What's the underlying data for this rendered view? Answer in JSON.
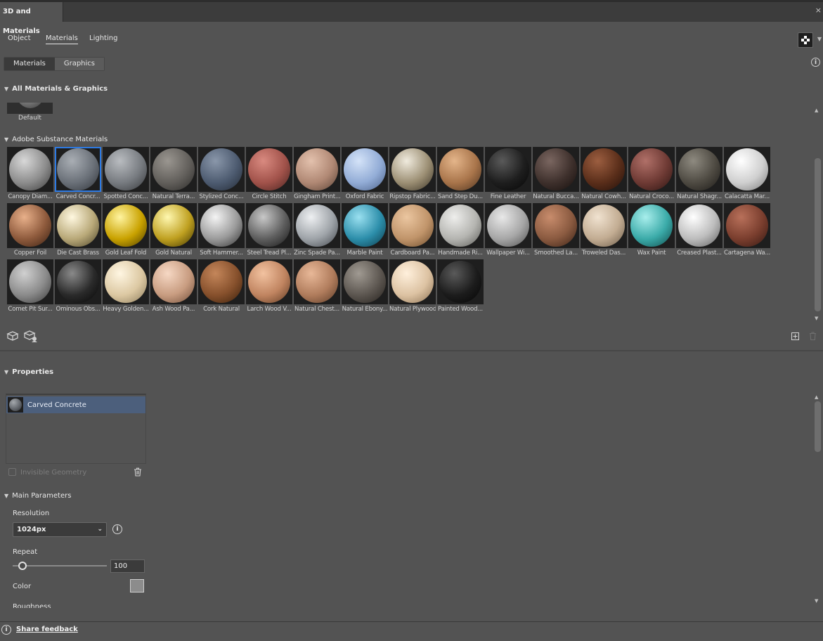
{
  "panel": {
    "title": "3D and Materials",
    "close_icon": "×"
  },
  "top_tabs": [
    {
      "label": "Object",
      "active": false
    },
    {
      "label": "Materials",
      "active": true
    },
    {
      "label": "Lighting",
      "active": false
    }
  ],
  "segment": {
    "materials": "Materials",
    "graphics": "Graphics",
    "active": "Materials"
  },
  "sections": {
    "all": "All Materials & Graphics",
    "default_label": "Default",
    "substance": "Adobe Substance Materials",
    "properties": "Properties",
    "main_params": "Main Parameters"
  },
  "materials": [
    {
      "label": "Canopy Diam...",
      "c": [
        "#d8d8d8",
        "#8c8c8c",
        "#3a3a3a"
      ]
    },
    {
      "label": "Carved Concr...",
      "c": [
        "#a9aeb4",
        "#6a7078",
        "#30343a"
      ],
      "selected": true
    },
    {
      "label": "Spotted Conc...",
      "c": [
        "#b9bcc0",
        "#777b80",
        "#35373a"
      ]
    },
    {
      "label": "Natural Terra...",
      "c": [
        "#9a9690",
        "#625f5b",
        "#2b2a28"
      ]
    },
    {
      "label": "Stylized Conc...",
      "c": [
        "#8a97aa",
        "#4d5b70",
        "#232a35"
      ]
    },
    {
      "label": "Circle Stitch",
      "c": [
        "#d98a80",
        "#a1524a",
        "#4a2420"
      ]
    },
    {
      "label": "Gingham Print...",
      "c": [
        "#e3c1ad",
        "#b08874",
        "#5a4235"
      ]
    },
    {
      "label": "Oxford Fabric",
      "c": [
        "#d4e3f8",
        "#92acd6",
        "#4a6088"
      ]
    },
    {
      "label": "Ripstop Fabric...",
      "c": [
        "#f0ebde",
        "#9c8f74",
        "#3a3326"
      ]
    },
    {
      "label": "Sand Step Du...",
      "c": [
        "#e4b58a",
        "#a8744a",
        "#4d331f"
      ]
    },
    {
      "label": "Fine Leather",
      "c": [
        "#5a5a5a",
        "#1e1e1e",
        "#050505"
      ]
    },
    {
      "label": "Natural Bucca...",
      "c": [
        "#7a6660",
        "#3e302c",
        "#160f0d"
      ]
    },
    {
      "label": "Natural Cowh...",
      "c": [
        "#9c5e40",
        "#5a2e1a",
        "#22100a"
      ]
    },
    {
      "label": "Natural Croco...",
      "c": [
        "#b07068",
        "#6e3a34",
        "#2c1512"
      ]
    },
    {
      "label": "Natural Shagr...",
      "c": [
        "#8e8a80",
        "#4e4a42",
        "#1c1a17"
      ]
    },
    {
      "label": "Calacatta Mar...",
      "c": [
        "#ffffff",
        "#cfcfcf",
        "#7a7a7a"
      ]
    },
    {
      "label": "Copper Foil",
      "c": [
        "#e8b08a",
        "#8e5a3c",
        "#3a2012"
      ]
    },
    {
      "label": "Die Cast Brass",
      "c": [
        "#fff8e0",
        "#b8a878",
        "#4a4228"
      ]
    },
    {
      "label": "Gold Leaf Fold",
      "c": [
        "#fff4a0",
        "#c9a200",
        "#4a3a00"
      ]
    },
    {
      "label": "Gold Natural",
      "c": [
        "#fff8b0",
        "#bfa020",
        "#3e3300"
      ]
    },
    {
      "label": "Soft Hammer...",
      "c": [
        "#f4f4f4",
        "#9a9a9a",
        "#303030"
      ]
    },
    {
      "label": "Steel Tread Pl...",
      "c": [
        "#c8c8c8",
        "#5e5e5e",
        "#161616"
      ]
    },
    {
      "label": "Zinc Spade Pa...",
      "c": [
        "#eef0f2",
        "#9ea3a8",
        "#40444a"
      ]
    },
    {
      "label": "Marble Paint",
      "c": [
        "#9ae0f0",
        "#2c8eaa",
        "#0c3a4a"
      ]
    },
    {
      "label": "Cardboard Pa...",
      "c": [
        "#ebc6a0",
        "#c0946a",
        "#6a4a2a"
      ]
    },
    {
      "label": "Handmade Ri...",
      "c": [
        "#eeeeec",
        "#b4b4b0",
        "#5a5a56"
      ]
    },
    {
      "label": "Wallpaper Wi...",
      "c": [
        "#e8e8e8",
        "#a6a6a6",
        "#4e4e4e"
      ]
    },
    {
      "label": "Smoothed La...",
      "c": [
        "#c88c6c",
        "#8a5a40",
        "#3a2216"
      ]
    },
    {
      "label": "Troweled Das...",
      "c": [
        "#f0e2d0",
        "#c2ac92",
        "#6a5a48"
      ]
    },
    {
      "label": "Wax Paint",
      "c": [
        "#a8eeec",
        "#3aaaa8",
        "#104a4a"
      ]
    },
    {
      "label": "Creased Plast...",
      "c": [
        "#ffffff",
        "#bcbcbc",
        "#5e5e5e"
      ]
    },
    {
      "label": "Cartagena Wa...",
      "c": [
        "#b8705a",
        "#7a3e2e",
        "#341812"
      ]
    },
    {
      "label": "Comet Pit Sur...",
      "c": [
        "#d0d0d0",
        "#8a8a8a",
        "#383838"
      ]
    },
    {
      "label": "Ominous Obs...",
      "c": [
        "#8a8a8a",
        "#2a2a2a",
        "#050505"
      ]
    },
    {
      "label": "Heavy Golden...",
      "c": [
        "#fff6e2",
        "#dcc8a2",
        "#8a7a5a"
      ]
    },
    {
      "label": "Ash Wood Pa...",
      "c": [
        "#f6d8c4",
        "#c89c80",
        "#6e4c38"
      ]
    },
    {
      "label": "Cork Natural",
      "c": [
        "#c4865a",
        "#86502c",
        "#3a200c"
      ]
    },
    {
      "label": "Larch Wood V...",
      "c": [
        "#f2c2a0",
        "#c08460",
        "#5e3a22"
      ]
    },
    {
      "label": "Natural Chest...",
      "c": [
        "#e8b898",
        "#b07c5c",
        "#5a3a26"
      ]
    },
    {
      "label": "Natural Ebony...",
      "c": [
        "#a09a92",
        "#5c5650",
        "#24201c"
      ]
    },
    {
      "label": "Natural Plywood",
      "c": [
        "#fff0dc",
        "#dcc2a2",
        "#8a7052"
      ]
    },
    {
      "label": "Painted Wood...",
      "c": [
        "#5a5a5a",
        "#1c1c1c",
        "#040404"
      ]
    }
  ],
  "properties": {
    "selected_item": "Carved Concrete",
    "invisible_geometry": "Invisible Geometry"
  },
  "main_parameters": {
    "resolution_label": "Resolution",
    "resolution_value": "1024px",
    "repeat_label": "Repeat",
    "repeat_value": "100",
    "color_label": "Color",
    "color_value": "#8c8c8c",
    "cut_label": "Roughness"
  },
  "footer": {
    "feedback": "Share feedback"
  },
  "info_icon": "i"
}
